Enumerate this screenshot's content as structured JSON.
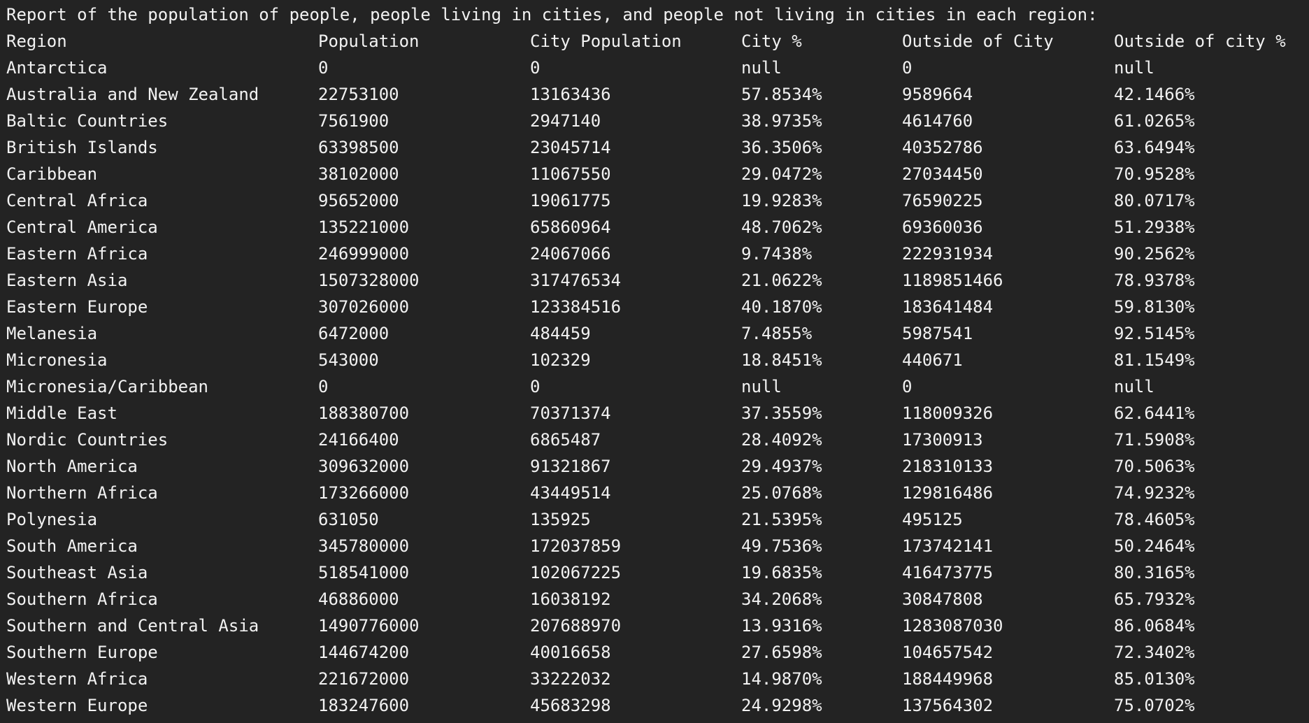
{
  "report": {
    "title": "Report of the population of people, people living in cities, and people not living in cities in each region:",
    "headers": [
      "Region",
      "Population",
      "City Population",
      "City %",
      "Outside of City",
      "Outside of city %"
    ],
    "rows": [
      [
        "Antarctica",
        "0",
        "0",
        "null",
        "0",
        "null"
      ],
      [
        "Australia and New Zealand",
        "22753100",
        "13163436",
        "57.8534%",
        "9589664",
        "42.1466%"
      ],
      [
        "Baltic Countries",
        "7561900",
        "2947140",
        "38.9735%",
        "4614760",
        "61.0265%"
      ],
      [
        "British Islands",
        "63398500",
        "23045714",
        "36.3506%",
        "40352786",
        "63.6494%"
      ],
      [
        "Caribbean",
        "38102000",
        "11067550",
        "29.0472%",
        "27034450",
        "70.9528%"
      ],
      [
        "Central Africa",
        "95652000",
        "19061775",
        "19.9283%",
        "76590225",
        "80.0717%"
      ],
      [
        "Central America",
        "135221000",
        "65860964",
        "48.7062%",
        "69360036",
        "51.2938%"
      ],
      [
        "Eastern Africa",
        "246999000",
        "24067066",
        "9.7438%",
        "222931934",
        "90.2562%"
      ],
      [
        "Eastern Asia",
        "1507328000",
        "317476534",
        "21.0622%",
        "1189851466",
        "78.9378%"
      ],
      [
        "Eastern Europe",
        "307026000",
        "123384516",
        "40.1870%",
        "183641484",
        "59.8130%"
      ],
      [
        "Melanesia",
        "6472000",
        "484459",
        "7.4855%",
        "5987541",
        "92.5145%"
      ],
      [
        "Micronesia",
        "543000",
        "102329",
        "18.8451%",
        "440671",
        "81.1549%"
      ],
      [
        "Micronesia/Caribbean",
        "0",
        "0",
        "null",
        "0",
        "null"
      ],
      [
        "Middle East",
        "188380700",
        "70371374",
        "37.3559%",
        "118009326",
        "62.6441%"
      ],
      [
        "Nordic Countries",
        "24166400",
        "6865487",
        "28.4092%",
        "17300913",
        "71.5908%"
      ],
      [
        "North America",
        "309632000",
        "91321867",
        "29.4937%",
        "218310133",
        "70.5063%"
      ],
      [
        "Northern Africa",
        "173266000",
        "43449514",
        "25.0768%",
        "129816486",
        "74.9232%"
      ],
      [
        "Polynesia",
        "631050",
        "135925",
        "21.5395%",
        "495125",
        "78.4605%"
      ],
      [
        "South America",
        "345780000",
        "172037859",
        "49.7536%",
        "173742141",
        "50.2464%"
      ],
      [
        "Southeast Asia",
        "518541000",
        "102067225",
        "19.6835%",
        "416473775",
        "80.3165%"
      ],
      [
        "Southern Africa",
        "46886000",
        "16038192",
        "34.2068%",
        "30847808",
        "65.7932%"
      ],
      [
        "Southern and Central Asia",
        "1490776000",
        "207688970",
        "13.9316%",
        "1283087030",
        "86.0684%"
      ],
      [
        "Southern Europe",
        "144674200",
        "40016658",
        "27.6598%",
        "104657542",
        "72.3402%"
      ],
      [
        "Western Africa",
        "221672000",
        "33222032",
        "14.9870%",
        "188449968",
        "85.0130%"
      ],
      [
        "Western Europe",
        "183247600",
        "45683298",
        "24.9298%",
        "137564302",
        "75.0702%"
      ]
    ]
  }
}
